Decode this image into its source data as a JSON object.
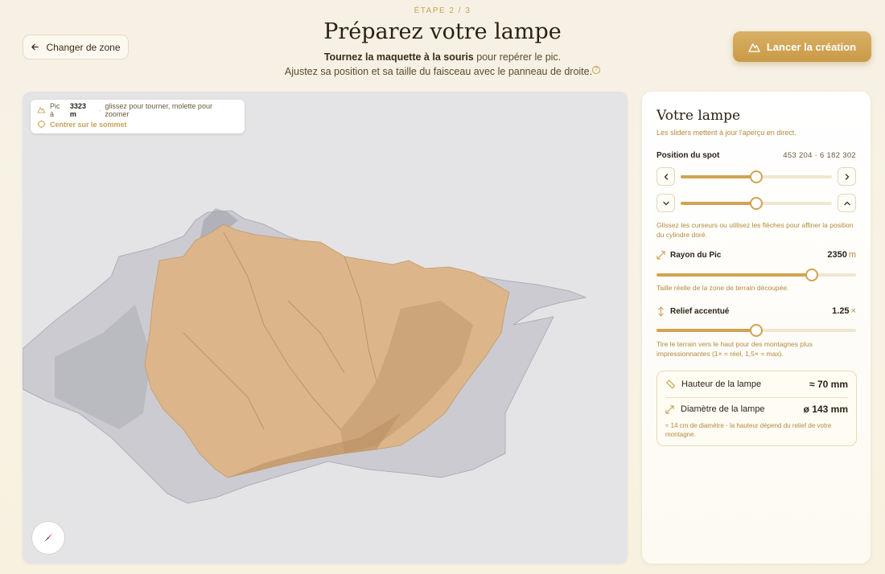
{
  "header": {
    "step": "ÉTAPE 2 / 3",
    "title": "Préparez votre lampe",
    "subtitle_bold": "Tournez la maquette à la souris",
    "subtitle_rest": " pour repérer le pic.",
    "subtitle_line2": "Ajustez sa position et sa taille du faisceau avec le panneau de droite.",
    "help_glyph": "?"
  },
  "back_button": {
    "label": "Changer de zone",
    "icon": "arrow-left-icon"
  },
  "launch_button": {
    "label": "Lancer la création",
    "icon": "mountain-icon"
  },
  "viewer": {
    "peak_prefix": "Pic à",
    "peak_altitude": "3323 m",
    "separator": "·",
    "hint": "glissez pour tourner, molette pour zoomer",
    "center_label": "Centrer sur le sommet",
    "terrain_color": "#dcb68a",
    "ghost_color": "#b7b7bf",
    "background_color": "#e4e4e6"
  },
  "panel": {
    "title": "Votre lampe",
    "subtitle": "Les sliders mettent à jour l'aperçu en direct.",
    "position": {
      "label": "Position du spot",
      "coords": "453 204 · 6 182 302",
      "horizontal_fraction": 0.5,
      "vertical_fraction": 0.5,
      "note": "Glissez les curseurs ou utilisez les flèches pour affiner la position du cylindre doré."
    },
    "radius": {
      "label": "Rayon du Pic",
      "value": "2350",
      "unit": "m",
      "fraction": 0.78,
      "note": "Taille réelle de la zone de terrain découpée."
    },
    "relief": {
      "label": "Relief accentué",
      "value": "1.25",
      "unit": "×",
      "fraction": 0.5,
      "note": "Tire le terrain vers le haut pour des montagnes plus impressionnantes (1× = réel, 1,5× = max)."
    },
    "lamp": {
      "height_label": "Hauteur de la lampe",
      "height_value": "≈ 70 mm",
      "diameter_label": "Diamètre de la lampe",
      "diameter_value": "ø 143 mm",
      "note": "≈ 14 cm de diamètre · la hauteur dépend du relief de votre montagne."
    }
  },
  "colors": {
    "accent": "#cfa452",
    "accent_text": "#b48a3c",
    "track": "#f1e6cf"
  }
}
